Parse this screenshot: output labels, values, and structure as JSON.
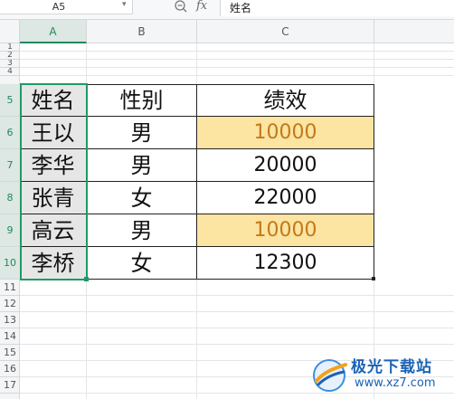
{
  "formula_bar": {
    "name_box": "A5",
    "formula_value": "姓名",
    "fx_label": "fx"
  },
  "columns": [
    "A",
    "B",
    "C"
  ],
  "rows": [
    "1",
    "2",
    "3",
    "4",
    "5",
    "6",
    "7",
    "8",
    "9",
    "10",
    "11",
    "12",
    "13",
    "14",
    "15",
    "16",
    "17"
  ],
  "table": {
    "headers": [
      "姓名",
      "性别",
      "绩效"
    ],
    "rows": [
      {
        "name": "王以",
        "gender": "男",
        "score": "10000",
        "highlight": true
      },
      {
        "name": "李华",
        "gender": "男",
        "score": "20000",
        "highlight": false
      },
      {
        "name": "张青",
        "gender": "女",
        "score": "22000",
        "highlight": false
      },
      {
        "name": "高云",
        "gender": "男",
        "score": "10000",
        "highlight": true
      },
      {
        "name": "李桥",
        "gender": "女",
        "score": "12300",
        "highlight": false
      }
    ]
  },
  "colors": {
    "selection": "#1f9a66",
    "highlight_fill": "#fce4a2",
    "highlight_text": "#c27a1a"
  },
  "watermark": {
    "title": "极光下载站",
    "url": "www.xz7.com"
  }
}
